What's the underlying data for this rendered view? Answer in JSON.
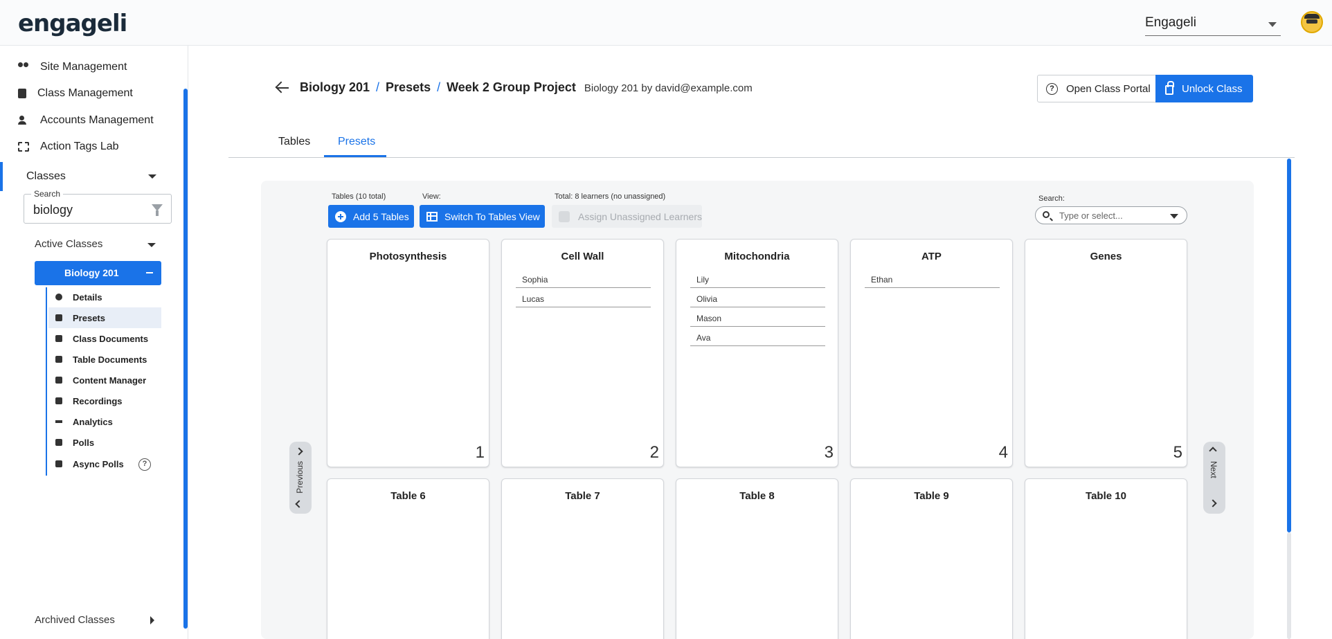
{
  "app": {
    "logo": "engageli",
    "org": "Engageli"
  },
  "sidebar": {
    "nav": [
      {
        "label": "Site Management",
        "icon": "people-icon"
      },
      {
        "label": "Class Management",
        "icon": "book-icon"
      },
      {
        "label": "Accounts Management",
        "icon": "account-icon"
      },
      {
        "label": "Action Tags Lab",
        "icon": "tags-icon"
      }
    ],
    "classes_label": "Classes",
    "search_legend": "Search",
    "search_value": "biology",
    "active_classes_label": "Active Classes",
    "selected_class": "Biology 201",
    "sub_items": [
      "Details",
      "Presets",
      "Class Documents",
      "Table Documents",
      "Content Manager",
      "Recordings",
      "Analytics",
      "Polls",
      "Async Polls"
    ],
    "help_glyph": "?",
    "archived_label": "Archived Classes"
  },
  "header": {
    "crumbs": [
      "Biology 201",
      "Presets",
      "Week 2 Group Project"
    ],
    "sep": "/",
    "subtitle": "Biology 201 by david@example.com",
    "open_portal": "Open Class Portal",
    "portal_glyph": "?",
    "unlock": "Unlock Class"
  },
  "tabs": [
    "Tables",
    "Presets"
  ],
  "toolbar": {
    "tables_label": "Tables (10 total)",
    "add_tables": "Add 5 Tables",
    "view_label": "View:",
    "switch_view": "Switch To Tables View",
    "total_label": "Total: 8 learners (no unassigned)",
    "assign_unassigned": "Assign Unassigned Learners",
    "search_label": "Search:",
    "search_placeholder": "Type or select..."
  },
  "tables": [
    {
      "name": "Photosynthesis",
      "number": "1",
      "learners": []
    },
    {
      "name": "Cell Wall",
      "number": "2",
      "learners": [
        "Sophia",
        "Lucas"
      ]
    },
    {
      "name": "Mitochondria",
      "number": "3",
      "learners": [
        "Lily",
        "Olivia",
        "Mason",
        "Ava"
      ]
    },
    {
      "name": "ATP",
      "number": "4",
      "learners": [
        "Ethan"
      ]
    },
    {
      "name": "Genes",
      "number": "5",
      "learners": []
    },
    {
      "name": "Table 6",
      "number": "",
      "learners": []
    },
    {
      "name": "Table 7",
      "number": "",
      "learners": []
    },
    {
      "name": "Table 8",
      "number": "",
      "learners": []
    },
    {
      "name": "Table 9",
      "number": "",
      "learners": []
    },
    {
      "name": "Table 10",
      "number": "",
      "learners": []
    }
  ],
  "pager": {
    "previous": "Previous",
    "next": "Next"
  },
  "colors": {
    "accent": "#1a73e8"
  }
}
